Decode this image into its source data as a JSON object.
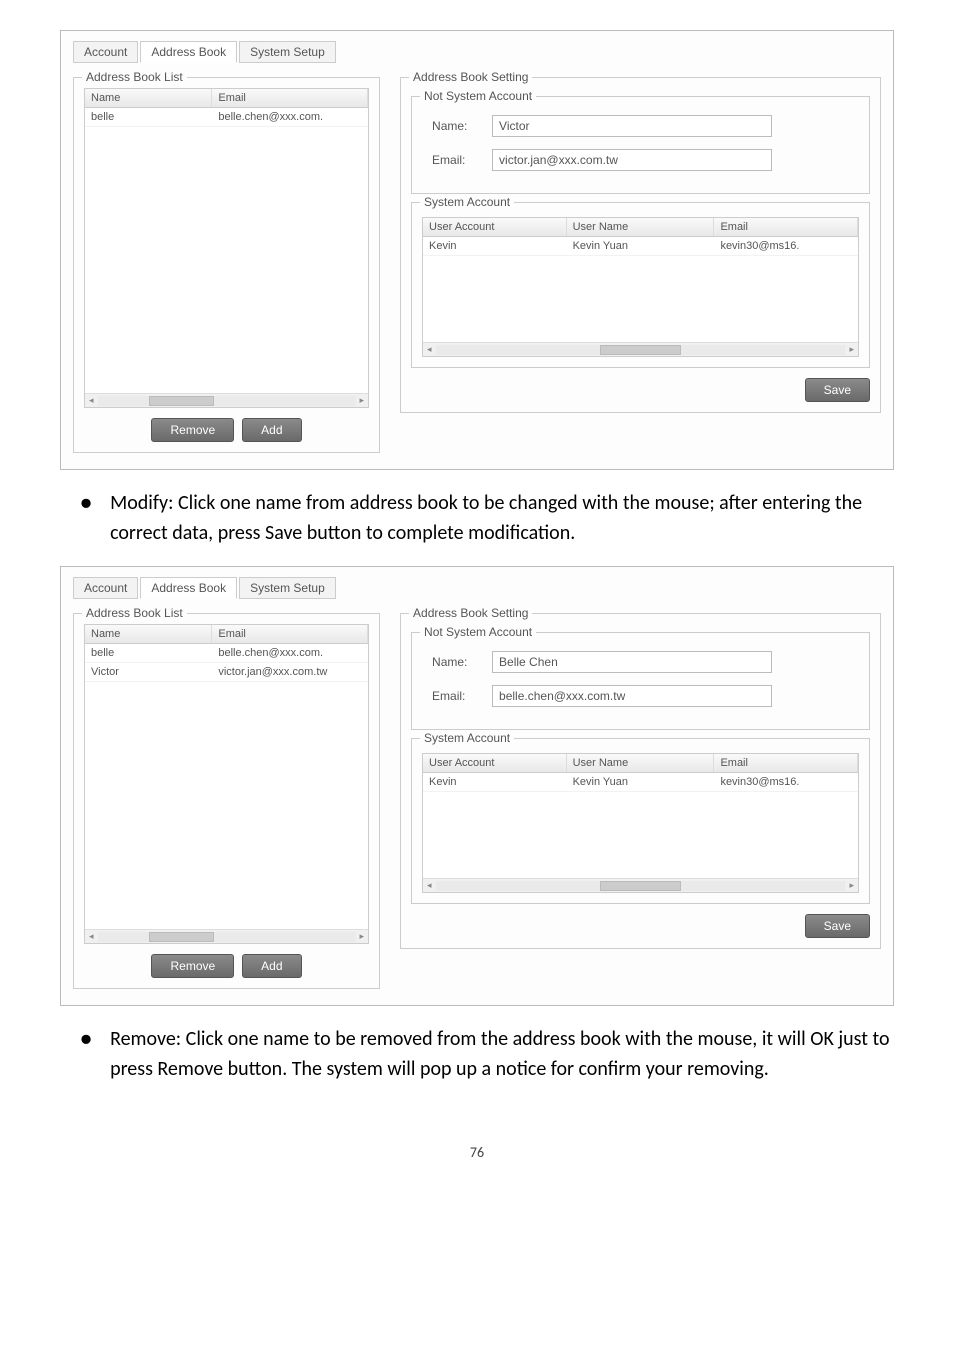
{
  "tabs": {
    "account": "Account",
    "address_book": "Address Book",
    "system_setup": "System Setup"
  },
  "labels": {
    "address_book_list": "Address Book List",
    "address_book_setting": "Address Book Setting",
    "not_system_account": "Not System Account",
    "system_account": "System Account",
    "name": "Name:",
    "email": "Email:"
  },
  "columns": {
    "name": "Name",
    "email": "Email",
    "user_account": "User Account",
    "user_name": "User Name",
    "email_col": "Email"
  },
  "buttons": {
    "remove": "Remove",
    "add": "Add",
    "save": "Save"
  },
  "screenshot1": {
    "list_rows": [
      {
        "name": "belle",
        "email": "belle.chen@xxx.com."
      }
    ],
    "form": {
      "name_value": "Victor",
      "email_value": "victor.jan@xxx.com.tw"
    },
    "sys_rows": [
      {
        "user_account": "Kevin",
        "user_name": "Kevin Yuan",
        "email": "kevin30@ms16."
      }
    ]
  },
  "screenshot2": {
    "list_rows": [
      {
        "name": "belle",
        "email": "belle.chen@xxx.com."
      },
      {
        "name": "Victor",
        "email": "victor.jan@xxx.com.tw"
      }
    ],
    "form": {
      "name_value": "Belle Chen",
      "email_value": "belle.chen@xxx.com.tw"
    },
    "sys_rows": [
      {
        "user_account": "Kevin",
        "user_name": "Kevin Yuan",
        "email": "kevin30@ms16."
      }
    ]
  },
  "body_text": {
    "modify": "Modify: Click one name from address book to be changed with the mouse; after entering the correct data, press Save button to complete modification.",
    "remove": "Remove: Click one name to be removed from the address book with the mouse, it will OK just to press Remove button. The system will pop up a notice for confirm your removing."
  },
  "glyphs": {
    "bullet": "●",
    "scroll_left": "◂",
    "scroll_right": "▸",
    "scroll_mid": "•••"
  },
  "page_number": "76"
}
